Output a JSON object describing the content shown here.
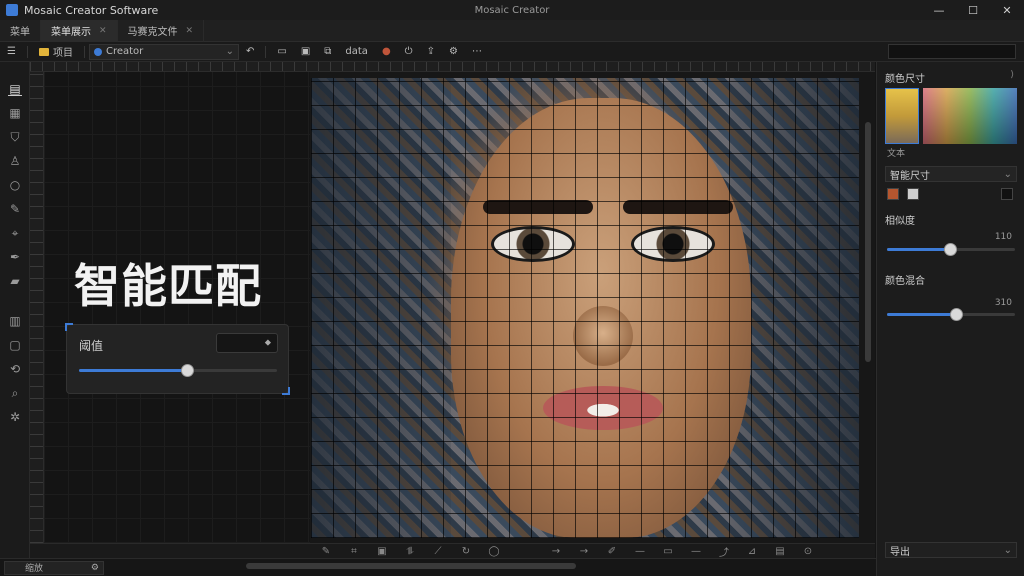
{
  "app": {
    "title": "Mosaic Creator Software",
    "window_title": "Mosaic Creator"
  },
  "window_controls": {
    "minimize": "—",
    "maximize": "☐",
    "close": "✕"
  },
  "tabs": [
    {
      "label": "菜单"
    },
    {
      "label": "菜单展示"
    },
    {
      "label": "马赛克文件"
    }
  ],
  "toolbar": {
    "project_label": "项目",
    "project_dropdown": "Creator",
    "data_label": "data"
  },
  "canvas": {
    "overlay_title": "智能匹配",
    "threshold": {
      "label": "阈值",
      "value": 0.55
    }
  },
  "right_panel": {
    "color_section": "颜色尺寸",
    "tile_label": "文本",
    "tile_size_select": "智能尺寸",
    "similarity_label": "相似度",
    "similarity_max": "110",
    "similarity_value": 0.5,
    "blend_label": "颜色混合",
    "blend_max": "310",
    "blend_value": 0.55,
    "bottom_select": "导出",
    "colors": {
      "accent": "#3d7bd6",
      "chip1": "#b5562f",
      "chip2": "#cfcfcf",
      "chip3": "#111111"
    }
  },
  "status": {
    "zoom": "缩放"
  }
}
